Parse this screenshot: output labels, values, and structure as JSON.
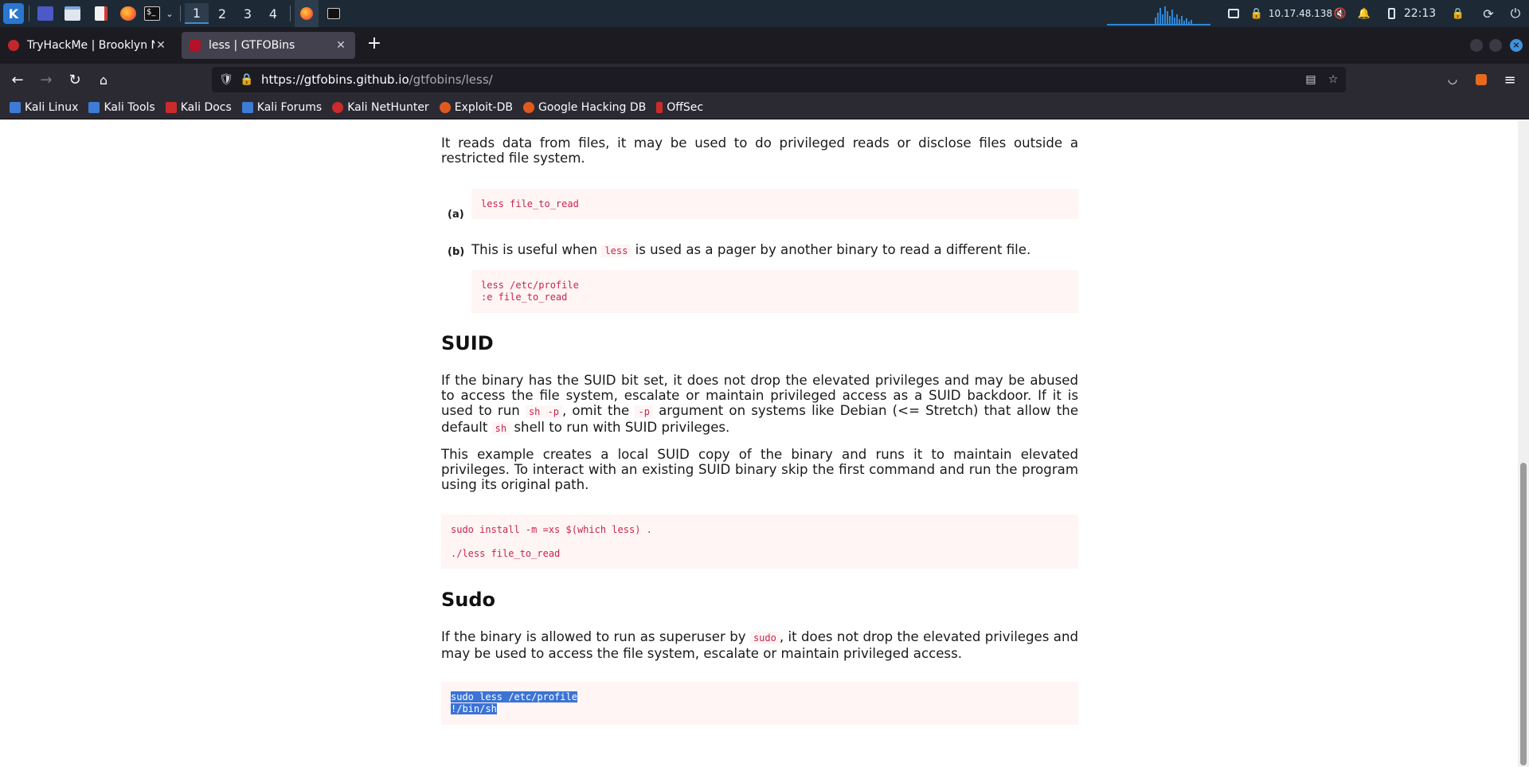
{
  "panel": {
    "workspaces": [
      "1",
      "2",
      "3",
      "4"
    ],
    "active_workspace": "1",
    "ip": "10.17.48.138",
    "clock": "22:13"
  },
  "tabs": [
    {
      "title": "TryHackMe | Brooklyn Nine Nine",
      "active": false,
      "favicon_color": "#c2272d"
    },
    {
      "title": "less | GTFOBins",
      "active": true,
      "favicon_color": "#b4122a"
    }
  ],
  "nav": {
    "url_domain": "https://gtfobins.github.io",
    "url_path": "/gtfobins/less/"
  },
  "bookmarks": [
    {
      "label": "Kali Linux",
      "icon": "kali-dragon-icon",
      "color": "#3c7cd6"
    },
    {
      "label": "Kali Tools",
      "icon": "kali-tools-icon",
      "color": "#3c7cd6"
    },
    {
      "label": "Kali Docs",
      "icon": "kali-docs-icon",
      "color": "#cc2b2b"
    },
    {
      "label": "Kali Forums",
      "icon": "kali-forums-icon",
      "color": "#3c7cd6"
    },
    {
      "label": "Kali NetHunter",
      "icon": "nethunter-icon",
      "color": "#cc2b2b"
    },
    {
      "label": "Exploit-DB",
      "icon": "exploit-db-icon",
      "color": "#e05a1f"
    },
    {
      "label": "Google Hacking DB",
      "icon": "ghdb-icon",
      "color": "#e05a1f"
    },
    {
      "label": "OffSec",
      "icon": "offsec-icon",
      "color": "#cc2b2b"
    }
  ],
  "content": {
    "file_read_intro": "It reads data from files, it may be used to do privileged reads or disclose files outside a restricted file system.",
    "label_a": "(a)",
    "code_a": "less file_to_read",
    "label_b": "(b)",
    "b_text_1": "This is useful when",
    "b_code": "less",
    "b_text_2": "is used as a pager by another binary to read a different file.",
    "code_b_line1": "less /etc/profile",
    "code_b_line2": ":e file_to_read",
    "suid_heading": "SUID",
    "suid_p1_a": "If the binary has the SUID bit set, it does not drop the elevated privileges and may be abused to access the file system, escalate or maintain privileged access as a SUID backdoor. If it is used to run",
    "suid_p1_code1": "sh -p",
    "suid_p1_b": ", omit the",
    "suid_p1_code2": "-p",
    "suid_p1_c": "argument on systems like Debian (<= Stretch) that allow the default",
    "suid_p1_code3": "sh",
    "suid_p1_d": "shell to run with SUID privileges.",
    "suid_p2": "This example creates a local SUID copy of the binary and runs it to maintain elevated privileges. To interact with an existing SUID binary skip the first command and run the program using its original path.",
    "suid_code_line1": "sudo install -m =xs $(which less) .",
    "suid_code_line2": "./less file_to_read",
    "sudo_heading": "Sudo",
    "sudo_p_a": "If the binary is allowed to run as superuser by",
    "sudo_p_code": "sudo",
    "sudo_p_b": ", it does not drop the elevated privileges and may be used to access the file system, escalate or maintain privileged access.",
    "sudo_code_line1": "sudo less /etc/profile",
    "sudo_code_line2": "!/bin/sh"
  }
}
